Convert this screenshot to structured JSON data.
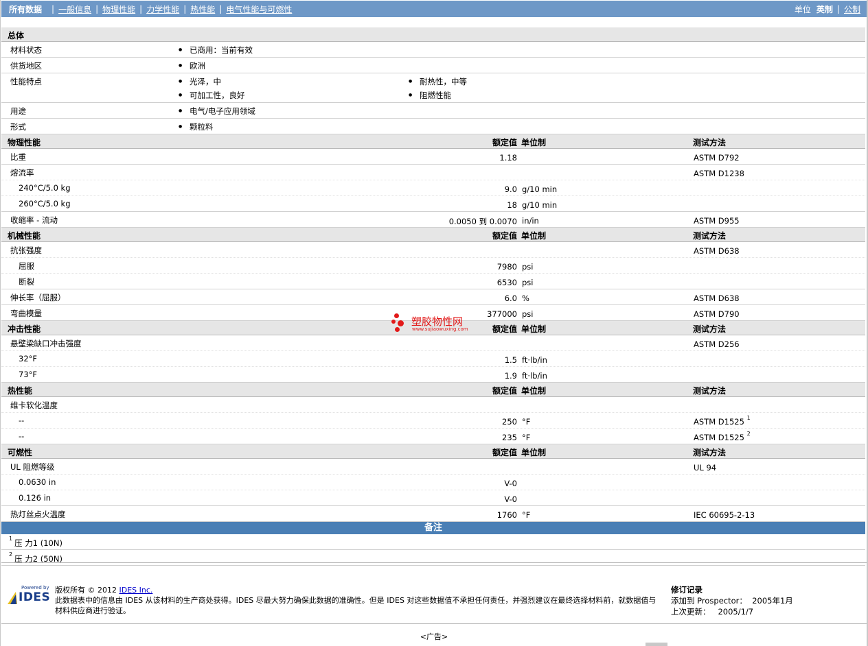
{
  "nav": {
    "lead": "所有数据",
    "links": [
      "一般信息",
      "物理性能",
      "力学性能",
      "热性能",
      "电气性能与可燃性"
    ],
    "units_label": "单位",
    "unit_current": "英制",
    "unit_other": "公制"
  },
  "general": {
    "title": "总体",
    "rows": [
      {
        "name": "材料状态",
        "items": [
          "已商用：当前有效"
        ]
      },
      {
        "name": "供货地区",
        "items": [
          "欧洲"
        ]
      },
      {
        "name": "性能特点",
        "items": [
          "光泽，中",
          "耐热性，中等",
          "可加工性，良好",
          "阻燃性能"
        ]
      },
      {
        "name": "用途",
        "items": [
          "电气/电子应用领域"
        ]
      },
      {
        "name": "形式",
        "items": [
          "颗粒料"
        ]
      }
    ]
  },
  "headers": {
    "value": "额定值",
    "unit": "单位制",
    "method": "测试方法"
  },
  "sections": [
    {
      "title": "物理性能",
      "rows": [
        {
          "name": "比重",
          "value": "1.18",
          "unit": "",
          "method": "ASTM D792",
          "indent": false
        },
        {
          "name": "熔流率",
          "value": "",
          "unit": "",
          "method": "ASTM D1238",
          "indent": false
        },
        {
          "name": "240°C/5.0 kg",
          "value": "9.0",
          "unit": "g/10 min",
          "method": "",
          "indent": true
        },
        {
          "name": "260°C/5.0 kg",
          "value": "18",
          "unit": "g/10 min",
          "method": "",
          "indent": true
        },
        {
          "name": "收缩率  - 流动",
          "value": "0.0050 到  0.0070",
          "unit": "in/in",
          "method": "ASTM D955",
          "indent": false
        }
      ]
    },
    {
      "title": "机械性能",
      "rows": [
        {
          "name": "抗张强度",
          "value": "",
          "unit": "",
          "method": "ASTM D638",
          "indent": false
        },
        {
          "name": "屈服",
          "value": "7980",
          "unit": "psi",
          "method": "",
          "indent": true
        },
        {
          "name": "断裂",
          "value": "6530",
          "unit": "psi",
          "method": "",
          "indent": true
        },
        {
          "name": "伸长率（屈服）",
          "value": "6.0",
          "unit": "%",
          "method": "ASTM D638",
          "indent": false
        },
        {
          "name": "弯曲模量",
          "value": "377000",
          "unit": "psi",
          "method": "ASTM D790",
          "indent": false
        }
      ]
    },
    {
      "title": "冲击性能",
      "rows": [
        {
          "name": "悬壁梁缺口冲击强度",
          "value": "",
          "unit": "",
          "method": "ASTM D256",
          "indent": false
        },
        {
          "name": "32°F",
          "value": "1.5",
          "unit": "ft·lb/in",
          "method": "",
          "indent": true
        },
        {
          "name": "73°F",
          "value": "1.9",
          "unit": "ft·lb/in",
          "method": "",
          "indent": true
        }
      ]
    },
    {
      "title": "热性能",
      "rows": [
        {
          "name": "维卡软化温度",
          "value": "",
          "unit": "",
          "method": "",
          "indent": false
        },
        {
          "name": "--",
          "value": "250",
          "unit": "°F",
          "method": "ASTM D1525",
          "sup": "1",
          "indent": true
        },
        {
          "name": "--",
          "value": "235",
          "unit": "°F",
          "method": "ASTM D1525",
          "sup": "2",
          "indent": true
        }
      ]
    },
    {
      "title": "可燃性",
      "rows": [
        {
          "name": "UL 阻燃等级",
          "value": "",
          "unit": "",
          "method": "UL 94",
          "indent": false
        },
        {
          "name": "0.0630 in",
          "value": "V-0",
          "unit": "",
          "method": "",
          "indent": true
        },
        {
          "name": "0.126 in",
          "value": "V-0",
          "unit": "",
          "method": "",
          "indent": true
        },
        {
          "name": "热灯丝点火温度",
          "value": "1760",
          "unit": "°F",
          "method": "IEC 60695-2-13",
          "indent": false
        }
      ]
    }
  ],
  "notes": {
    "title": "备注",
    "items": [
      {
        "sup": "1",
        "text": "压 力1 (10N)"
      },
      {
        "sup": "2",
        "text": "压 力2 (50N)"
      }
    ]
  },
  "footer": {
    "powered_by": "Powered by",
    "logo_text": "IDES",
    "copyright_prefix": "版权所有  © 2012 ",
    "copyright_link": "IDES Inc.",
    "disclaimer": "此数据表中的信息由  IDES 从该材料的生产商处获得。IDES 尽最大努力确保此数据的准确性。但是  IDES 对这些数据值不承担任何责任，并强烈建议在最终选择材料前，就数据值与材料供应商进行验证。",
    "revision_title": "修订记录",
    "added_label": "添加到  Prospector：",
    "added_value": "2005年1月",
    "updated_label": "上次更新：",
    "updated_value": "2005/1/7"
  },
  "ad": "<广告>",
  "watermark": {
    "title": "塑胶物性网",
    "url": "www.sujiaowuxing.com"
  },
  "colors": {
    "nav": "#6e98c7",
    "notes_bar": "#4a7fb5",
    "section": "#e6e6e6",
    "watermark": "#e21a1a"
  }
}
